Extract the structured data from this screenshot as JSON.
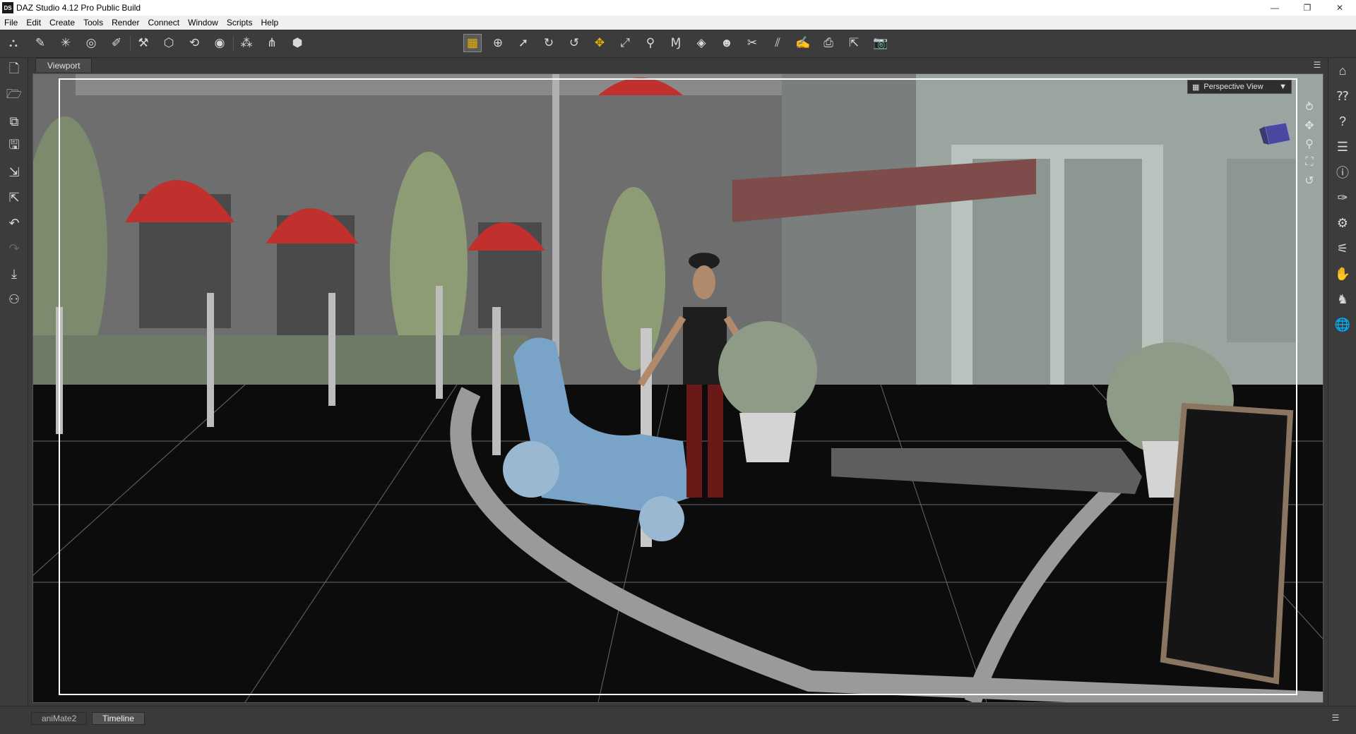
{
  "window": {
    "title": "DAZ Studio 4.12 Pro Public Build",
    "app_icon_text": "DS",
    "minimize": "—",
    "restore": "❐",
    "close": "✕"
  },
  "menu": {
    "items": [
      "File",
      "Edit",
      "Create",
      "Tools",
      "Render",
      "Connect",
      "Window",
      "Scripts",
      "Help"
    ]
  },
  "toolbar": {
    "left_icons": [
      "scene-icon",
      "node-weight-icon",
      "joint-editor-icon",
      "geometry-editor-icon",
      "surface-selection-icon",
      "figure-setup-icon",
      "add-node-icon",
      "rotate-node-icon",
      "spot-render-icon",
      "add-bone-icon",
      "bone-icon",
      "cube-icon"
    ],
    "center_icons": [
      "active-pose-icon",
      "universal-tool-icon",
      "node-selection-icon",
      "rotate-tool-icon",
      "twist-tool-icon",
      "translate-tool-icon",
      "scale-tool-icon",
      "joint-editor-tool-icon",
      "geometry-tool-icon",
      "surface-tool-icon",
      "figure-tool-icon",
      "region-tool-icon",
      "weight-map-brush-icon",
      "node-weight-brush-icon",
      "render-camera-icon",
      "spot-tool-icon",
      "render-icon"
    ]
  },
  "left_toolbar": {
    "icons": [
      "new-scene-icon",
      "open-icon",
      "merge-icon",
      "save-icon",
      "import-icon",
      "export-icon",
      "undo-icon",
      "redo-icon",
      "drop-icon",
      "figure-icon"
    ]
  },
  "right_toolbar": {
    "icons": [
      "home-icon",
      "whats-this-icon",
      "help-icon",
      "list-icon",
      "info-icon",
      "brush-icon",
      "tool-settings-icon",
      "parameters-icon",
      "hand-icon",
      "pose-icon",
      "globe-icon"
    ]
  },
  "viewport": {
    "tab_label": "Viewport",
    "view_name": "Perspective View",
    "view_dropdown_arrow": "▼",
    "controls": [
      "orbit-icon",
      "pan-icon",
      "zoom-icon",
      "frame-icon",
      "reset-icon"
    ]
  },
  "bottom": {
    "tabs": [
      "aniMate2",
      "Timeline"
    ],
    "active_tab": "Timeline"
  },
  "colors": {
    "app_bg": "#3a3a3a",
    "toolbar_bg": "#3c3c3c",
    "active_tool": "#e8b000",
    "awning_red": "#c0302c",
    "scooter_blue": "#7aa3c8"
  }
}
